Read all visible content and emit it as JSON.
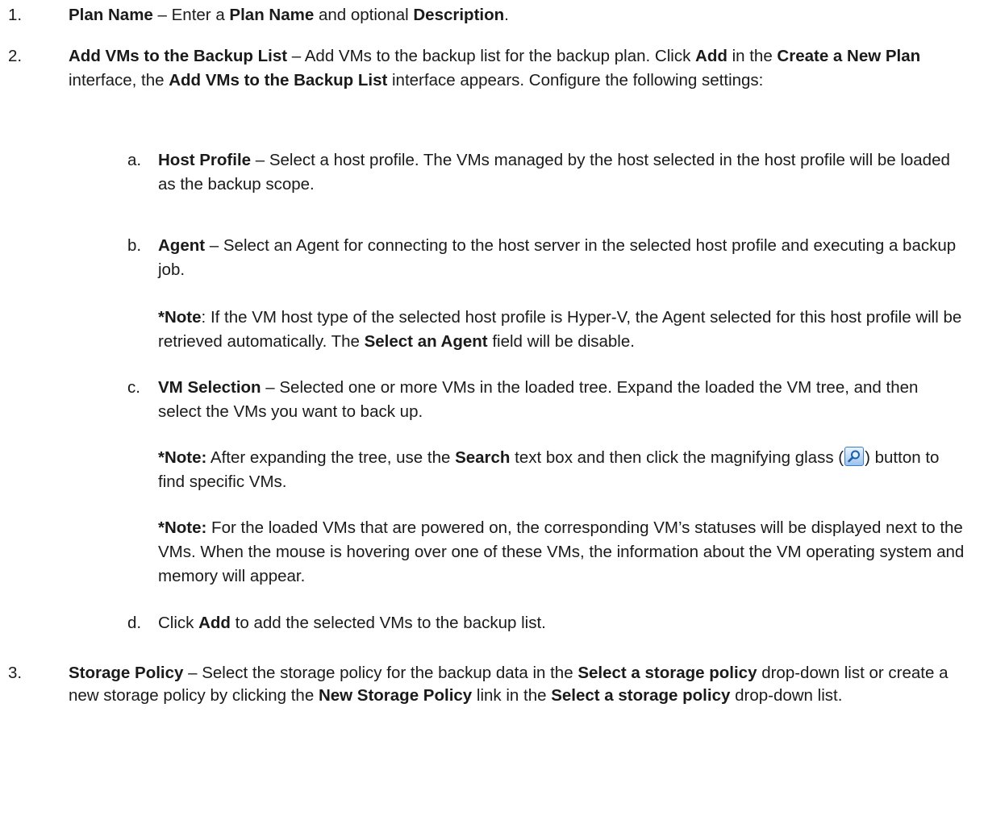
{
  "step1": {
    "num": "1.",
    "title": "Plan Name",
    "dash": " – Enter a ",
    "b1": "Plan Name",
    "mid": " and optional ",
    "b2": "Description",
    "end": "."
  },
  "step2": {
    "num": "2.",
    "title": "Add VMs to the Backup List",
    "t1": " – Add VMs to the backup list for the backup plan. Click ",
    "b1": "Add",
    "t2": " in the ",
    "b2": "Create a New Plan",
    "t3": " interface, the ",
    "b3": "Add VMs to the Backup List",
    "t4": " interface appears. Configure the following settings:",
    "a": {
      "num": "a.",
      "title": "Host Profile",
      "text": " – Select a host profile. The VMs managed by the host selected in the host profile will be loaded as the backup scope."
    },
    "b": {
      "num": "b.",
      "title": "Agent",
      "text": " – Select an Agent for connecting to the host server in the selected host profile and executing a backup job.",
      "note_prefix": "*Note",
      "note_t1": ": If the VM host type of the selected host profile is Hyper-V, the Agent selected for this host profile will be retrieved automatically. The ",
      "note_b1": "Select an Agent",
      "note_t2": " field will be disable."
    },
    "c": {
      "num": "c.",
      "title": "VM Selection",
      "text": " – Selected one or more VMs in the loaded tree. Expand the loaded the VM tree, and then select the VMs you want to back up.",
      "note1_prefix": "*Note:",
      "note1_t1": " After expanding the tree, use the ",
      "note1_b1": "Search",
      "note1_t2": " text box and then click the magnifying glass (",
      "note1_icon": "magnifying-glass-icon",
      "note1_t3": ") button to find specific VMs.",
      "note2_prefix": "*Note:",
      "note2_t1": " For the loaded VMs that are powered on, the corresponding VM’s statuses will be displayed next to the VMs. When the mouse is hovering over one of these VMs, the information about the VM operating system and memory will appear."
    },
    "d": {
      "num": "d.",
      "t1": "Click ",
      "b1": "Add",
      "t2": " to add the selected VMs to the backup list."
    }
  },
  "step3": {
    "num": "3.",
    "title": "Storage Policy",
    "t1": " – Select the storage policy for the backup data in the ",
    "b1": "Select a storage policy",
    "t2": " drop-down list or create a new storage policy by clicking the ",
    "b2": "New Storage Policy",
    "t3": " link in the ",
    "b3": "Select a storage policy",
    "t4": " drop-down list."
  }
}
